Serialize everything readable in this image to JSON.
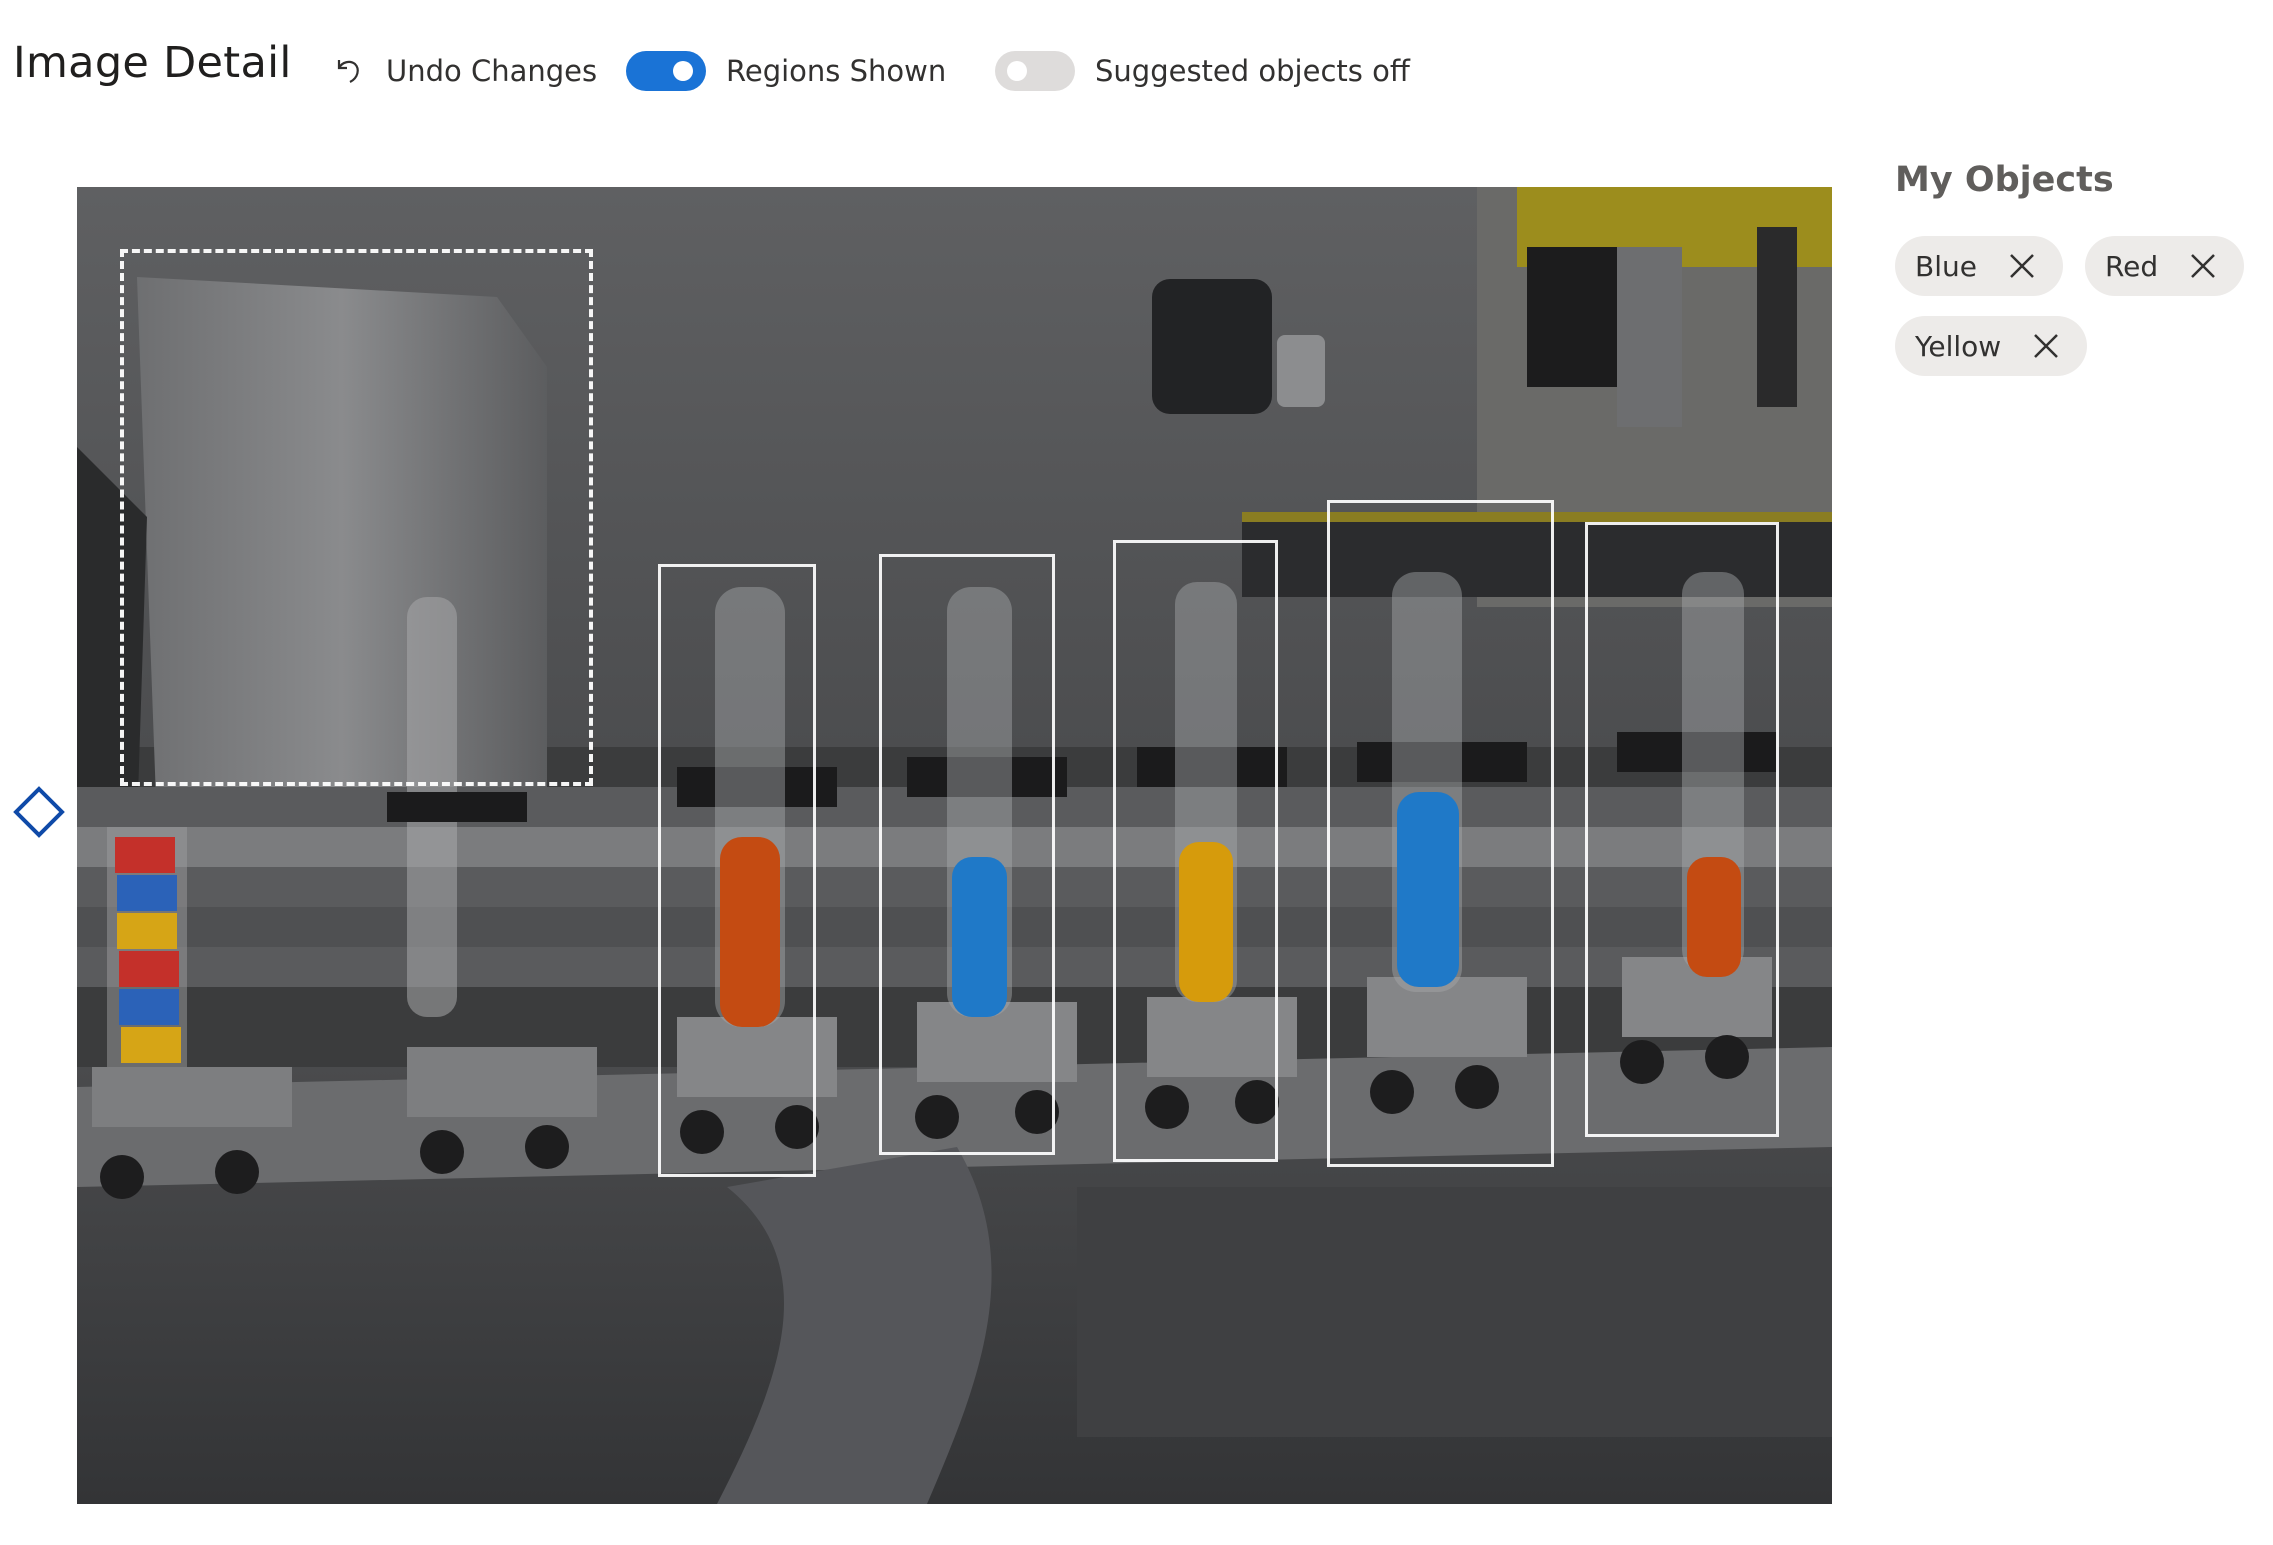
{
  "header": {
    "title": "Image Detail",
    "undo_label": "Undo Changes",
    "regions_toggle": {
      "label": "Regions Shown",
      "state": "on"
    },
    "suggested_toggle": {
      "label": "Suggested objects off",
      "state": "off"
    }
  },
  "image": {
    "regions": [
      {
        "index": 1,
        "selected": true
      },
      {
        "index": 2,
        "selected": false
      },
      {
        "index": 3,
        "selected": false
      },
      {
        "index": 4,
        "selected": false
      },
      {
        "index": 5,
        "selected": false
      },
      {
        "index": 6,
        "selected": false
      }
    ]
  },
  "objects_panel": {
    "title": "My Objects",
    "tags": [
      {
        "label": "Blue"
      },
      {
        "label": "Red"
      },
      {
        "label": "Yellow"
      }
    ]
  },
  "colors": {
    "accent": "#1a73d6",
    "toggle_off": "#dedcdb",
    "chip_bg": "#edebe9",
    "liquid_orange": "#c44b12",
    "liquid_blue": "#1f79c8",
    "liquid_yellow": "#d69b0c"
  },
  "icons": [
    "undo-icon",
    "close-icon",
    "resize-handle-icon"
  ]
}
